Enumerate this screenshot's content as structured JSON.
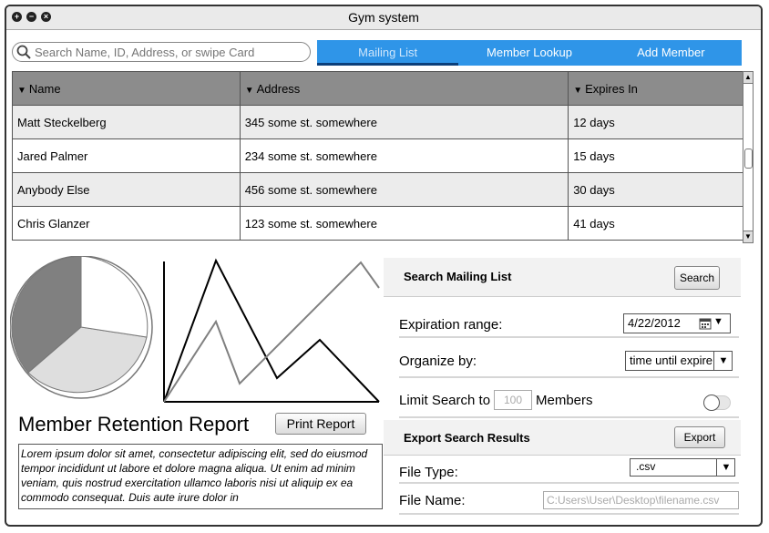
{
  "window": {
    "title": "Gym system"
  },
  "search": {
    "placeholder": "Search Name, ID, Address, or swipe Card"
  },
  "tabs": [
    {
      "label": "Mailing List",
      "active": true
    },
    {
      "label": "Member Lookup",
      "active": false
    },
    {
      "label": "Add Member",
      "active": false
    }
  ],
  "table": {
    "columns": [
      "Name",
      "Address",
      "Expires In"
    ],
    "rows": [
      [
        "Matt Steckelberg",
        "345 some st. somewhere",
        "12 days"
      ],
      [
        "Jared Palmer",
        "234 some st. somewhere",
        "15 days"
      ],
      [
        "Anybody Else",
        "456 some st. somewhere",
        "30 days"
      ],
      [
        "Chris Glanzer",
        "123 some st. somewhere",
        "41 days"
      ]
    ]
  },
  "report": {
    "title": "Member Retention Report",
    "print_label": "Print Report",
    "text": "Lorem ipsum dolor sit amet, consectetur adipiscing elit, sed do eiusmod tempor incididunt ut labore et dolore magna aliqua. Ut enim ad minim veniam, quis nostrud exercitation ullamco laboris nisi ut aliquip ex ea commodo consequat. Duis aute irure dolor in"
  },
  "search_panel": {
    "heading": "Search Mailing List",
    "search_label": "Search",
    "expiration_label": "Expiration range:",
    "expiration_value": "4/22/2012",
    "organize_label": "Organize by:",
    "organize_value": "time until expire",
    "limit_label_pre": "Limit Search to",
    "limit_value": "100",
    "limit_label_post": "Members"
  },
  "export_panel": {
    "heading": "Export Search Results",
    "export_label": "Export",
    "filetype_label": "File Type:",
    "filetype_value": ".csv",
    "filename_label": "File Name:",
    "filename_placeholder": "C:Users\\User\\Desktop\\filename.csv"
  },
  "colors": {
    "tab_bar": "#2f95e8",
    "header": "#8c8c8c"
  }
}
